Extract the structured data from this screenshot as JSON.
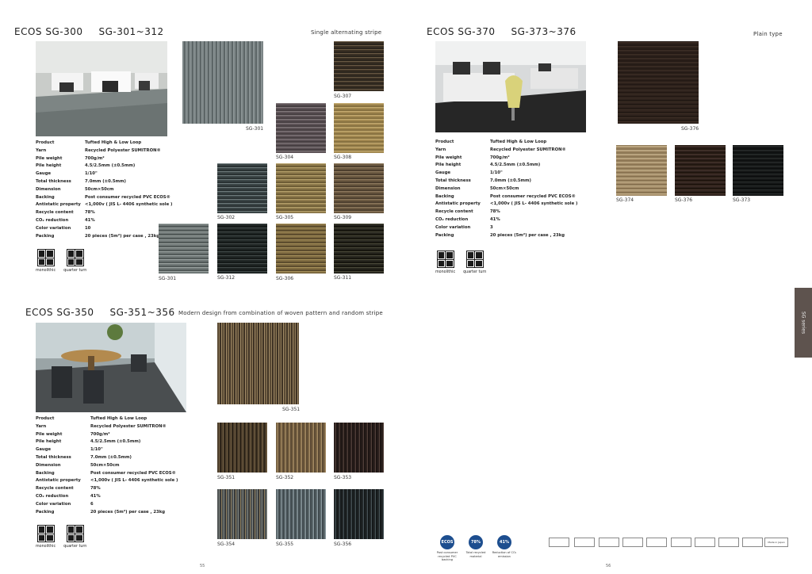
{
  "sections": {
    "sg300": {
      "title_a": "ECOS  SG-300",
      "title_b": "SG-301~312",
      "subtitle": "Single alternating stripe",
      "specs": [
        {
          "k": "Product",
          "v": "Tufted High & Low Loop"
        },
        {
          "k": "Yarn",
          "v": "Recycled Polyester SUMITRON®"
        },
        {
          "k": "Pile weight",
          "v": "700g/m²"
        },
        {
          "k": "Pile height",
          "v": "4.5/2.5mm  (±0.5mm)"
        },
        {
          "k": "Gauge",
          "v": "1/10\""
        },
        {
          "k": "Total thickness",
          "v": "7.0mm (±0.5mm)"
        },
        {
          "k": "Dimension",
          "v": "50cm×50cm"
        },
        {
          "k": "Backing",
          "v": "Post consumer recycled PVC ECOS®"
        },
        {
          "k": "Antistatic property",
          "v": "<1,000v ( JIS L- 4406 synthetic sole )"
        },
        {
          "k": "Recycle content",
          "v": "78%"
        },
        {
          "k": "CO₂ reduction",
          "v": "41%"
        },
        {
          "k": "Color variation",
          "v": "10"
        },
        {
          "k": "Packing",
          "v": "20 pieces (5m²) per case , 23kg"
        }
      ],
      "tiles": [
        "SG-301",
        "SG-307",
        "SG-304",
        "SG-308",
        "SG-302",
        "SG-305",
        "SG-309",
        "SG-301",
        "SG-312",
        "SG-306",
        "SG-311"
      ]
    },
    "sg370": {
      "title_a": "ECOS  SG-370",
      "title_b": "SG-373~376",
      "subtitle": "Plain type",
      "specs": [
        {
          "k": "Product",
          "v": "Tufted High & Low Loop"
        },
        {
          "k": "Yarn",
          "v": "Recycled Polyester SUMITRON®"
        },
        {
          "k": "Pile weight",
          "v": "700g/m²"
        },
        {
          "k": "Pile height",
          "v": "4.5/2.5mm  (±0.5mm)"
        },
        {
          "k": "Gauge",
          "v": "1/10\""
        },
        {
          "k": "Total thickness",
          "v": "7.0mm (±0.5mm)"
        },
        {
          "k": "Dimension",
          "v": "50cm×50cm"
        },
        {
          "k": "Backing",
          "v": "Post consumer recycled PVC ECOS®"
        },
        {
          "k": "Antistatic property",
          "v": "<1,000v ( JIS L- 4406 synthetic sole )"
        },
        {
          "k": "Recycle content",
          "v": "78%"
        },
        {
          "k": "CO₂ reduction",
          "v": "41%"
        },
        {
          "k": "Color variation",
          "v": "3"
        },
        {
          "k": "Packing",
          "v": "20 pieces (5m²) per case , 23kg"
        }
      ],
      "tiles": [
        "SG-376",
        "SG-374",
        "SG-376",
        "SG-373"
      ]
    },
    "sg350": {
      "title_a": "ECOS  SG-350",
      "title_b": "SG-351~356",
      "subtitle": "Modern design from combination of woven pattern and random stripe",
      "specs": [
        {
          "k": "Product",
          "v": "Tufted High & Low Loop"
        },
        {
          "k": "Yarn",
          "v": "Recycled Polyester SUMITRON®"
        },
        {
          "k": "Pile weight",
          "v": "700g/m²"
        },
        {
          "k": "Pile height",
          "v": "4.5/2.5mm  (±0.5mm)"
        },
        {
          "k": "Gauge",
          "v": "1/10\""
        },
        {
          "k": "Total thickness",
          "v": "7.0mm (±0.5mm)"
        },
        {
          "k": "Dimension",
          "v": "50cm×50cm"
        },
        {
          "k": "Backing",
          "v": "Post consumer recycled PVC ECOS®"
        },
        {
          "k": "Antistatic property",
          "v": "<1,000v ( JIS L- 4406 synthetic sole )"
        },
        {
          "k": "Recycle content",
          "v": "78%"
        },
        {
          "k": "CO₂ reduction",
          "v": "41%"
        },
        {
          "k": "Color variation",
          "v": "6"
        },
        {
          "k": "Packing",
          "v": "20 pieces (5m²) per case , 23kg"
        }
      ],
      "tiles": [
        "SG-351",
        "SG-351",
        "SG-352",
        "SG-353",
        "SG-354",
        "SG-355",
        "SG-356"
      ]
    }
  },
  "installation": {
    "monolithic": "monolithic",
    "quarter_turn": "quarter turn"
  },
  "side_tab": "SG series",
  "page_left": "55",
  "page_right": "56",
  "eco_badges": [
    {
      "symbol": "ECOS",
      "text": "Post consumer recycled PVC backing"
    },
    {
      "symbol": "78%",
      "text": "Total recycled material"
    },
    {
      "symbol": "41%",
      "text": "Reduction of CO₂ emission"
    }
  ],
  "cert_labels": [
    "",
    "",
    "",
    "",
    "",
    "",
    "",
    "",
    "",
    "",
    "Made in Japan"
  ]
}
